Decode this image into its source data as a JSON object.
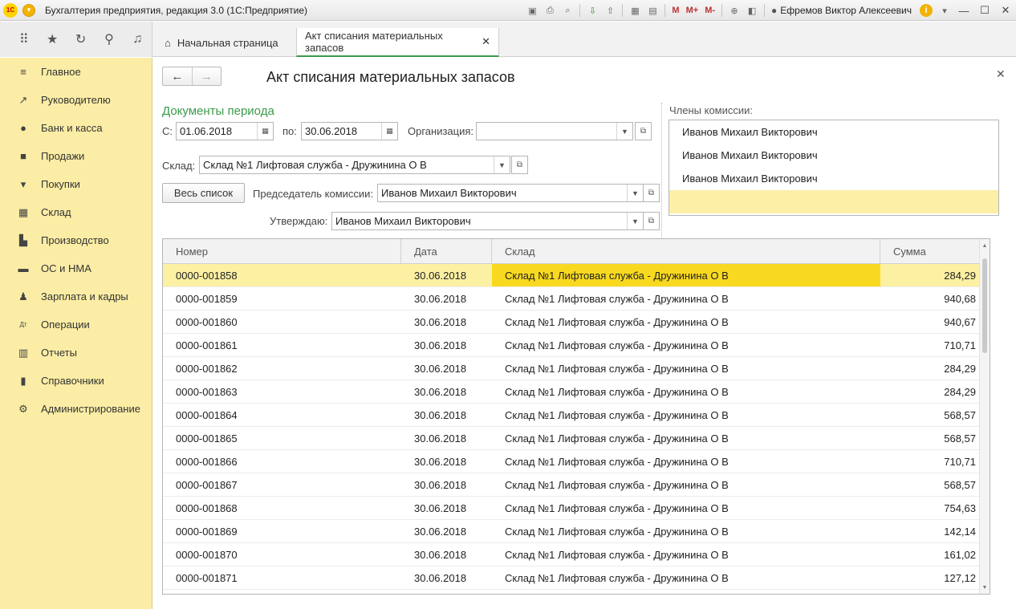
{
  "app": {
    "title": "Бухгалтерия предприятия, редакция 3.0  (1С:Предприятие)",
    "logo_text": "1С",
    "user": "Ефремов Виктор Алексеевич",
    "toolbar": {
      "m": "M",
      "mplus": "M+",
      "mminus": "M-"
    }
  },
  "tabs": {
    "home": "Начальная страница",
    "active": "Акт списания материальных запасов"
  },
  "sidebar": {
    "items": [
      {
        "label": "Главное",
        "icon": "menu-icon"
      },
      {
        "label": "Руководителю",
        "icon": "trend-icon"
      },
      {
        "label": "Банк и касса",
        "icon": "coin-icon"
      },
      {
        "label": "Продажи",
        "icon": "bag-icon"
      },
      {
        "label": "Покупки",
        "icon": "cart-icon"
      },
      {
        "label": "Склад",
        "icon": "warehouse-icon"
      },
      {
        "label": "Производство",
        "icon": "factory-icon"
      },
      {
        "label": "ОС и НМА",
        "icon": "truck-icon"
      },
      {
        "label": "Зарплата и кадры",
        "icon": "person-icon"
      },
      {
        "label": "Операции",
        "icon": "dt-kt-icon"
      },
      {
        "label": "Отчеты",
        "icon": "bar-chart-icon"
      },
      {
        "label": "Справочники",
        "icon": "book-icon"
      },
      {
        "label": "Администрирование",
        "icon": "gear-icon"
      }
    ]
  },
  "form": {
    "title": "Акт списания материальных запасов",
    "period_title": "Документы периода",
    "from_label": "С:",
    "from_value": "01.06.2018",
    "to_label": "по:",
    "to_value": "30.06.2018",
    "org_label": "Организация:",
    "org_value": "",
    "warehouse_label": "Склад:",
    "warehouse_value": "Склад №1 Лифтовая служба - Дружинина О В",
    "full_list_button": "Весь список",
    "chairman_label": "Председатель комиссии:",
    "chairman_value": "Иванов Михаил Викторович",
    "approver_label": "Утверждаю:",
    "approver_value": "Иванов Михаил Викторович",
    "members_label": "Члены комиссии:",
    "members": [
      "Иванов Михаил Викторович",
      "Иванов Михаил Викторович",
      "Иванов Михаил Викторович",
      ""
    ]
  },
  "table": {
    "columns": [
      "Номер",
      "Дата",
      "Склад",
      "Сумма"
    ],
    "rows": [
      [
        "0000-001858",
        "30.06.2018",
        "Склад №1 Лифтовая служба - Дружинина О В",
        "284,29"
      ],
      [
        "0000-001859",
        "30.06.2018",
        "Склад №1 Лифтовая служба - Дружинина О В",
        "940,68"
      ],
      [
        "0000-001860",
        "30.06.2018",
        "Склад №1 Лифтовая служба - Дружинина О В",
        "940,67"
      ],
      [
        "0000-001861",
        "30.06.2018",
        "Склад №1 Лифтовая служба - Дружинина О В",
        "710,71"
      ],
      [
        "0000-001862",
        "30.06.2018",
        "Склад №1 Лифтовая служба - Дружинина О В",
        "284,29"
      ],
      [
        "0000-001863",
        "30.06.2018",
        "Склад №1 Лифтовая служба - Дружинина О В",
        "284,29"
      ],
      [
        "0000-001864",
        "30.06.2018",
        "Склад №1 Лифтовая служба - Дружинина О В",
        "568,57"
      ],
      [
        "0000-001865",
        "30.06.2018",
        "Склад №1 Лифтовая служба - Дружинина О В",
        "568,57"
      ],
      [
        "0000-001866",
        "30.06.2018",
        "Склад №1 Лифтовая служба - Дружинина О В",
        "710,71"
      ],
      [
        "0000-001867",
        "30.06.2018",
        "Склад №1 Лифтовая служба - Дружинина О В",
        "568,57"
      ],
      [
        "0000-001868",
        "30.06.2018",
        "Склад №1 Лифтовая служба - Дружинина О В",
        "754,63"
      ],
      [
        "0000-001869",
        "30.06.2018",
        "Склад №1 Лифтовая служба - Дружинина О В",
        "142,14"
      ],
      [
        "0000-001870",
        "30.06.2018",
        "Склад №1 Лифтовая служба - Дружинина О В",
        "161,02"
      ],
      [
        "0000-001871",
        "30.06.2018",
        "Склад №1 Лифтовая служба - Дружинина О В",
        "127,12"
      ]
    ]
  }
}
